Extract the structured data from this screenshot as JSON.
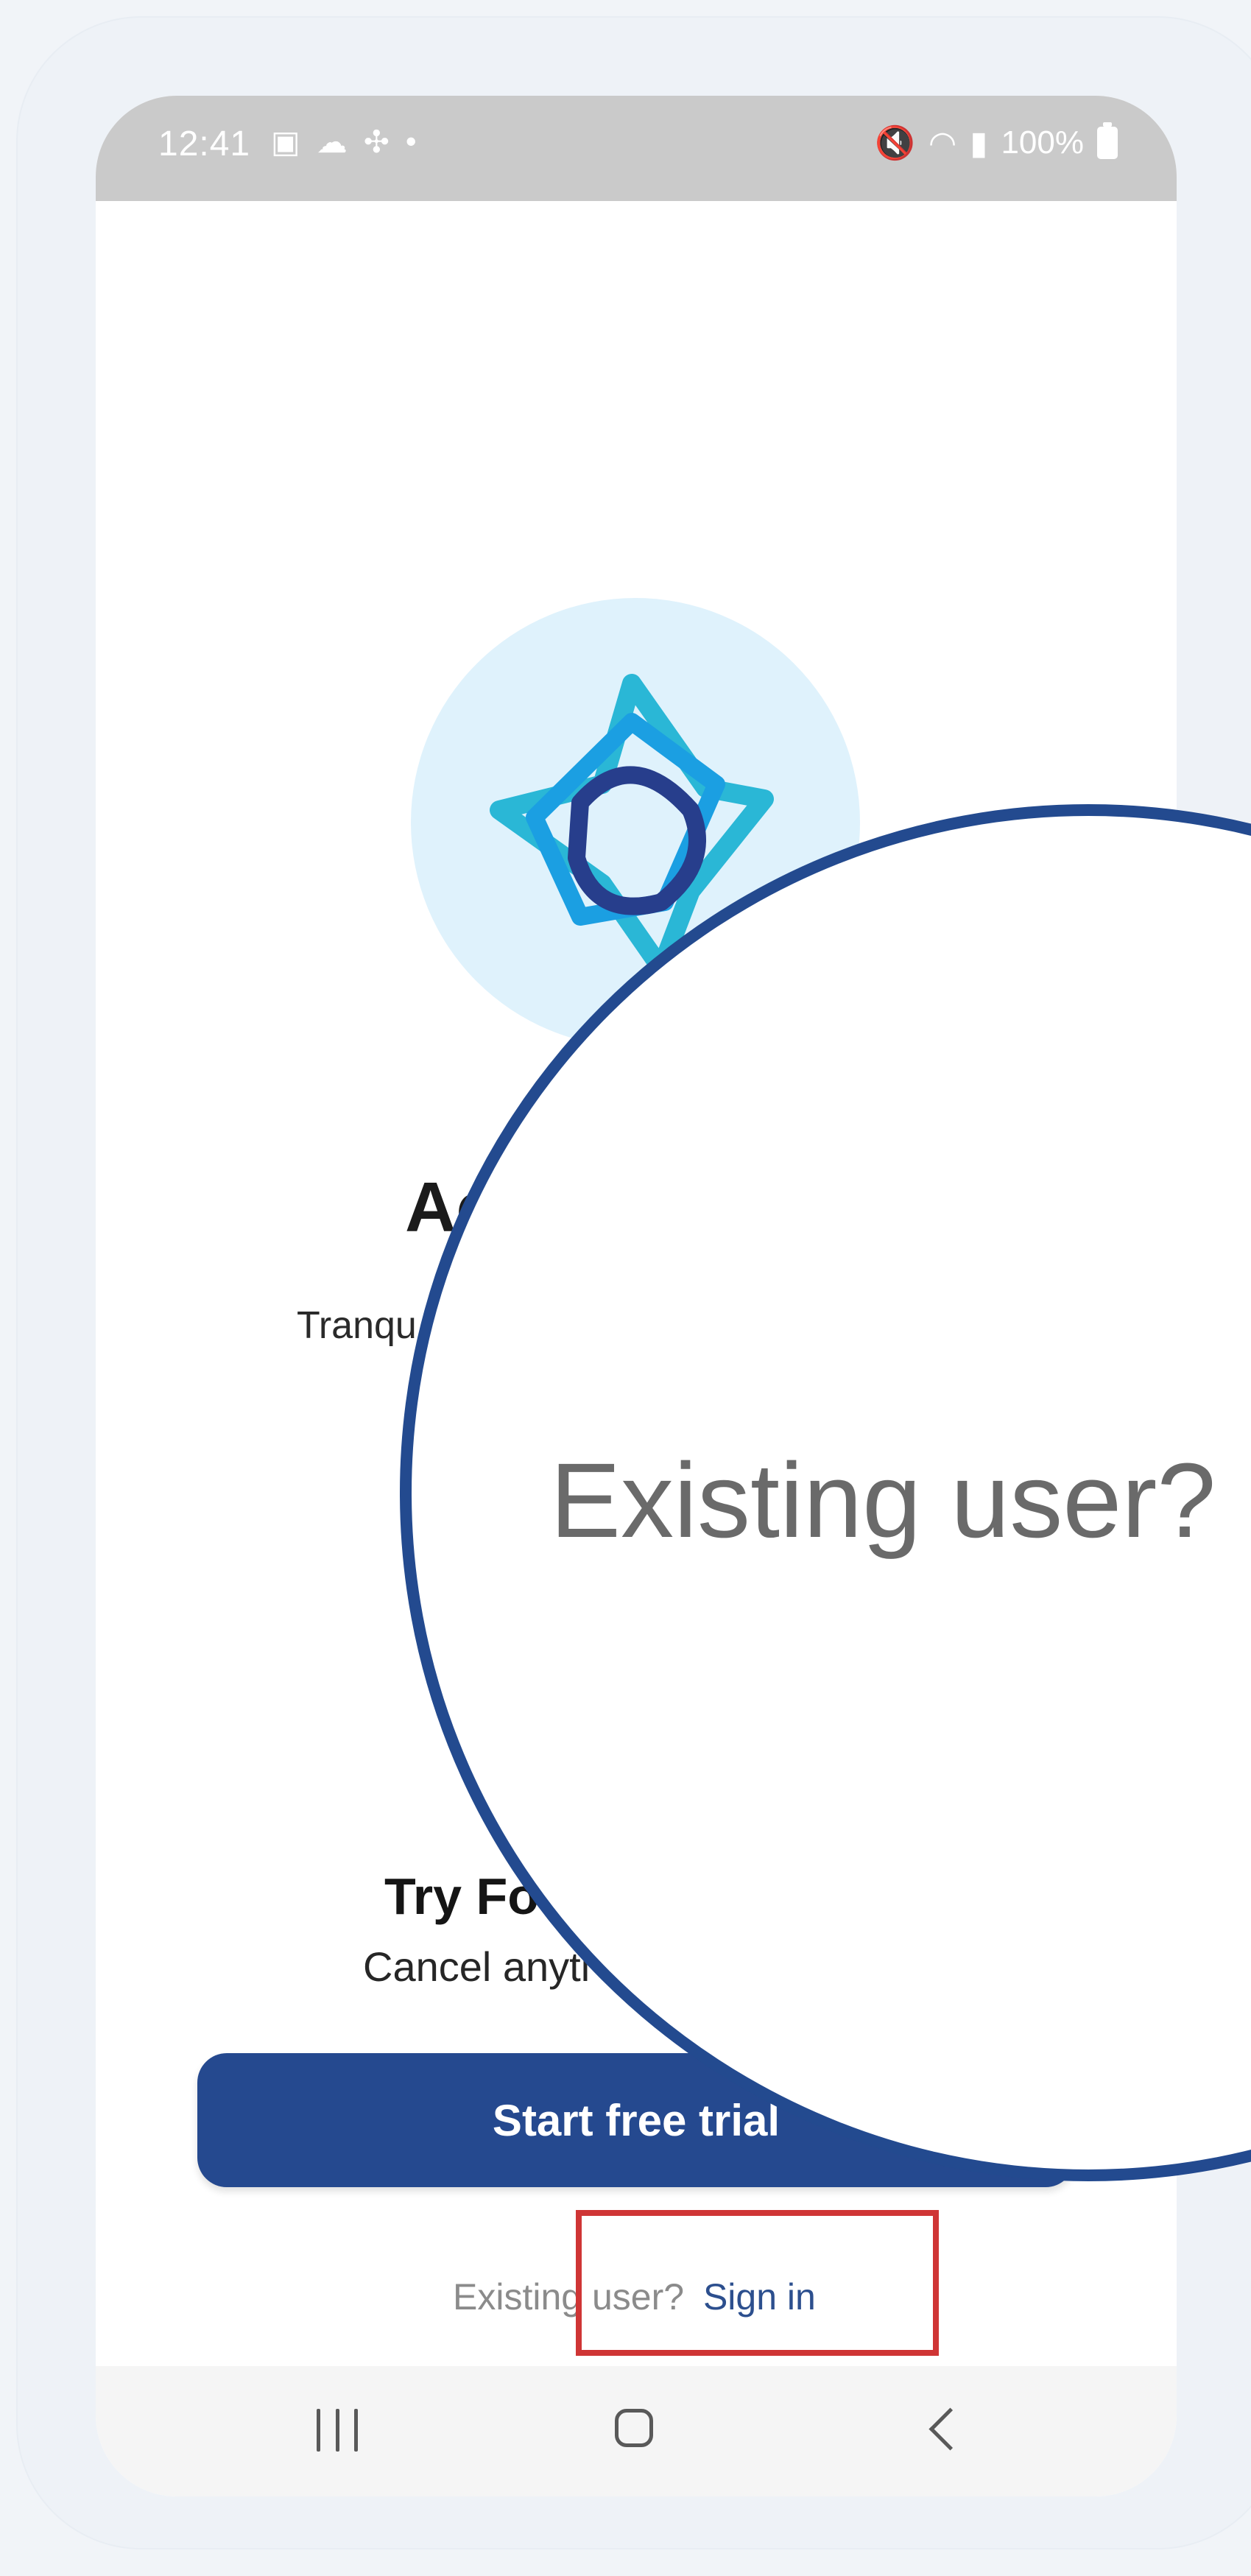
{
  "status_bar": {
    "time": "12:41",
    "left_icons": [
      "gallery-icon",
      "cloud-icon",
      "slack-icon",
      "dot-icon"
    ],
    "right_icons": [
      "mute-icon",
      "wifi-icon",
      "signal-icon"
    ],
    "battery_text": "100%"
  },
  "app": {
    "title": "Ac",
    "tagline": "Tranqu"
  },
  "trial": {
    "title": "Try Fo",
    "subtitle": "Cancel anyti",
    "button_label": "Start free trial"
  },
  "signin": {
    "prefix": "Existing user?",
    "link": "Sign in"
  },
  "magnifier": {
    "text": "Existing user?"
  },
  "colors": {
    "primary": "#25498f",
    "highlight": "#cf3535",
    "status_bar": "#cacaca",
    "logo_background": "#dff2fc"
  },
  "navigation": {
    "buttons": [
      "recent-apps-icon",
      "home-icon",
      "back-icon"
    ]
  }
}
